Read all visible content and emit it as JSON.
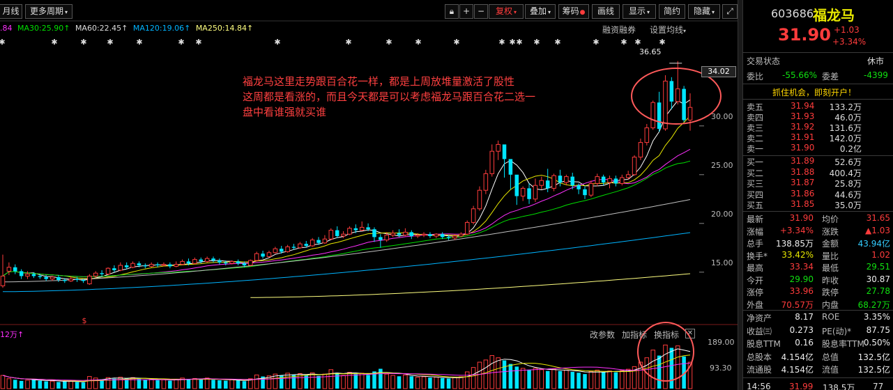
{
  "toolbar": {
    "left_tab_1": "月线",
    "left_tab_2": "更多周期",
    "fuquan": "复权",
    "diejia": "叠加",
    "chouma": "筹码",
    "huaxian": "画线",
    "xianshi": "显示",
    "jianyue": "简约",
    "yincang": "隐藏"
  },
  "ma_legend": {
    "ma_prev": ".84",
    "ma30": "MA30:25.90",
    "ma60": "MA60:22.45",
    "ma120": "MA120:19.06",
    "ma250": "MA250:14.84",
    "rongzi": "融资融券",
    "shezhi": "设置均线"
  },
  "colors": {
    "up": "#ff3c3c",
    "down": "#00e5ff",
    "ma5": "#ffffff",
    "ma10": "#e8e800",
    "ma20": "#ff30ff",
    "ma30": "#00e000",
    "ma60": "#c0c0c0",
    "ma120": "#00b4ff",
    "ma250": "#ffff80"
  },
  "annotation": {
    "line1": "福龙马这里走势跟百合花一样，都是上周放堆量激活了股性",
    "line2": "这周都是看涨的，而且今天都是可以考虑福龙马跟百合花二选一",
    "line3": "盘中看谁强就买谁"
  },
  "price_axis": {
    "current_tag": "34.02",
    "ticks": [
      "30.00",
      "25.00",
      "20.00",
      "15.00"
    ],
    "high_label": "36.65"
  },
  "volume_panel": {
    "legend": "12万",
    "gaicanshu": "改参数",
    "jiazhibiao": "加指标",
    "huanzhibiao": "换指标",
    "ticks": [
      "189.00",
      "93.30"
    ]
  },
  "chart_data": {
    "type": "candlestick",
    "title": "福龙马 603686",
    "y_ticks": [
      15.0,
      20.0,
      25.0,
      30.0,
      34.02
    ],
    "ylim": [
      12.2,
      37.2
    ],
    "high_marker": 36.65,
    "candles": [
      [
        13.6,
        14.6,
        16.8,
        13.4
      ],
      [
        15.1,
        15.5,
        16.0,
        14.7
      ],
      [
        15.5,
        15.1,
        15.8,
        14.8
      ],
      [
        15.1,
        14.6,
        15.3,
        14.3
      ],
      [
        14.6,
        14.8,
        15.1,
        14.3
      ],
      [
        14.8,
        14.6,
        15.0,
        14.4
      ],
      [
        14.6,
        14.5,
        14.8,
        14.3
      ],
      [
        14.5,
        14.3,
        14.7,
        14.1
      ],
      [
        14.3,
        14.5,
        14.6,
        14.1
      ],
      [
        14.5,
        14.2,
        14.7,
        14.0
      ],
      [
        14.2,
        14.1,
        14.4,
        13.9
      ],
      [
        14.1,
        14.3,
        14.6,
        14.0
      ],
      [
        14.3,
        14.2,
        14.5,
        14.0
      ],
      [
        14.2,
        14.1,
        14.3,
        13.9
      ],
      [
        13.8,
        14.6,
        14.8,
        13.7
      ],
      [
        14.6,
        14.9,
        15.1,
        14.4
      ],
      [
        14.9,
        14.8,
        15.2,
        14.6
      ],
      [
        14.8,
        15.4,
        15.5,
        14.7
      ],
      [
        15.4,
        15.2,
        15.7,
        15.0
      ],
      [
        15.2,
        15.7,
        16.0,
        15.1
      ],
      [
        15.7,
        15.5,
        16.0,
        15.3
      ],
      [
        15.5,
        15.9,
        16.1,
        15.4
      ],
      [
        15.9,
        15.7,
        16.1,
        15.5
      ],
      [
        15.7,
        15.6,
        15.9,
        15.4
      ],
      [
        15.6,
        15.8,
        16.0,
        15.5
      ],
      [
        15.8,
        15.7,
        16.0,
        15.5
      ],
      [
        15.7,
        15.8,
        16.0,
        15.6
      ],
      [
        15.8,
        15.6,
        16.0,
        15.4
      ],
      [
        15.6,
        15.8,
        16.1,
        15.5
      ],
      [
        15.8,
        16.1,
        16.3,
        15.7
      ],
      [
        16.1,
        15.9,
        16.4,
        15.7
      ],
      [
        15.9,
        16.3,
        16.5,
        15.8
      ],
      [
        16.3,
        16.1,
        16.5,
        15.9
      ],
      [
        16.1,
        16.4,
        16.6,
        16.0
      ],
      [
        16.4,
        16.2,
        16.6,
        16.0
      ],
      [
        16.2,
        16.0,
        16.4,
        15.8
      ],
      [
        16.0,
        15.9,
        16.2,
        15.7
      ],
      [
        15.9,
        16.1,
        16.2,
        15.8
      ],
      [
        16.1,
        15.9,
        16.3,
        15.7
      ],
      [
        15.9,
        15.7,
        16.1,
        15.5
      ],
      [
        15.7,
        16.2,
        16.3,
        15.6
      ],
      [
        16.2,
        16.9,
        17.1,
        16.1
      ],
      [
        16.9,
        16.6,
        17.2,
        16.4
      ],
      [
        16.6,
        17.0,
        17.2,
        16.5
      ],
      [
        17.0,
        17.4,
        17.6,
        16.9
      ],
      [
        17.4,
        17.1,
        17.7,
        16.9
      ],
      [
        17.1,
        17.6,
        17.8,
        17.0
      ],
      [
        17.6,
        17.5,
        17.9,
        17.3
      ],
      [
        17.5,
        17.9,
        18.1,
        17.4
      ],
      [
        17.9,
        17.7,
        18.2,
        17.5
      ],
      [
        17.7,
        18.3,
        18.5,
        17.6
      ],
      [
        18.3,
        18.0,
        18.6,
        17.8
      ],
      [
        18.0,
        18.4,
        18.8,
        17.9
      ],
      [
        18.4,
        19.3,
        19.5,
        18.3
      ],
      [
        19.3,
        18.7,
        19.7,
        18.5
      ],
      [
        18.7,
        18.9,
        19.2,
        18.5
      ],
      [
        18.9,
        19.5,
        19.7,
        18.8
      ],
      [
        19.5,
        19.3,
        19.9,
        19.0
      ],
      [
        19.3,
        19.6,
        20.2,
        19.2
      ],
      [
        19.6,
        19.4,
        20.0,
        19.2
      ],
      [
        19.4,
        18.6,
        19.6,
        18.1
      ],
      [
        18.6,
        18.3,
        18.9,
        17.5
      ],
      [
        18.3,
        18.8,
        19.1,
        18.1
      ],
      [
        18.8,
        19.0,
        19.3,
        18.6
      ],
      [
        19.0,
        18.8,
        19.4,
        18.6
      ],
      [
        18.8,
        19.1,
        19.5,
        18.7
      ],
      [
        19.1,
        18.7,
        19.3,
        18.4
      ],
      [
        18.7,
        18.8,
        19.0,
        18.5
      ],
      [
        18.8,
        18.9,
        19.1,
        18.6
      ],
      [
        18.9,
        18.7,
        19.1,
        18.5
      ],
      [
        18.7,
        18.9,
        19.0,
        18.5
      ],
      [
        18.9,
        18.6,
        19.1,
        18.4
      ],
      [
        18.6,
        18.5,
        18.8,
        18.3
      ],
      [
        18.5,
        18.7,
        18.9,
        18.3
      ],
      [
        18.7,
        18.9,
        19.1,
        18.6
      ],
      [
        18.9,
        20.1,
        20.3,
        18.8
      ],
      [
        20.1,
        21.5,
        21.8,
        19.9
      ],
      [
        21.5,
        23.4,
        23.8,
        21.3
      ],
      [
        23.4,
        25.1,
        25.5,
        23.0
      ],
      [
        25.1,
        27.4,
        28.1,
        24.8
      ],
      [
        27.4,
        28.1,
        28.5,
        26.5
      ],
      [
        28.1,
        26.6,
        27.9,
        24.7
      ],
      [
        26.6,
        25.0,
        26.4,
        23.5
      ],
      [
        25.0,
        22.8,
        24.6,
        21.9
      ],
      [
        22.8,
        23.6,
        23.8,
        22.3
      ],
      [
        23.6,
        22.5,
        24.1,
        22.0
      ],
      [
        22.5,
        23.9,
        24.6,
        22.2
      ],
      [
        23.9,
        24.4,
        24.8,
        23.5
      ],
      [
        24.4,
        23.6,
        25.6,
        23.2
      ],
      [
        23.6,
        24.9,
        25.1,
        23.3
      ],
      [
        24.9,
        24.2,
        25.5,
        23.8
      ],
      [
        24.2,
        24.8,
        25.0,
        23.9
      ],
      [
        24.8,
        23.9,
        25.2,
        23.5
      ],
      [
        23.9,
        23.5,
        24.1,
        23.0
      ],
      [
        23.5,
        22.9,
        23.8,
        22.5
      ],
      [
        22.9,
        24.1,
        24.4,
        22.7
      ],
      [
        24.1,
        24.8,
        25.1,
        23.8
      ],
      [
        24.8,
        24.2,
        25.0,
        23.9
      ],
      [
        24.2,
        24.6,
        24.9,
        23.6
      ],
      [
        24.6,
        24.1,
        24.9,
        23.8
      ],
      [
        24.1,
        24.7,
        25.0,
        23.9
      ],
      [
        24.7,
        25.0,
        25.4,
        24.5
      ],
      [
        25.0,
        26.8,
        27.0,
        24.9
      ],
      [
        26.8,
        28.3,
        28.7,
        26.5
      ],
      [
        28.3,
        29.8,
        30.2,
        28.0
      ],
      [
        29.8,
        32.4,
        32.6,
        29.6
      ],
      [
        32.4,
        29.7,
        33.5,
        29.4
      ],
      [
        29.7,
        34.6,
        35.2,
        29.5
      ],
      [
        34.6,
        32.5,
        35.0,
        31.7
      ],
      [
        32.5,
        33.8,
        36.65,
        32.2
      ],
      [
        33.8,
        30.6,
        34.1,
        30.4
      ],
      [
        30.6,
        31.9,
        33.34,
        29.51
      ]
    ],
    "ma_series": [
      {
        "name": "MA30",
        "last": 25.9
      },
      {
        "name": "MA60",
        "last": 22.45
      },
      {
        "name": "MA120",
        "last": 19.06
      },
      {
        "name": "MA250",
        "last": 14.84
      }
    ],
    "volume_ticks": [
      189.0,
      93.3
    ],
    "volume_max": 215,
    "volumes": [
      60,
      45,
      40,
      35,
      38,
      42,
      36,
      33,
      34,
      30,
      32,
      35,
      30,
      28,
      55,
      48,
      42,
      50,
      45,
      52,
      46,
      50,
      44,
      40,
      42,
      38,
      40,
      36,
      42,
      48,
      44,
      46,
      42,
      48,
      40,
      38,
      36,
      40,
      38,
      34,
      45,
      62,
      55,
      58,
      66,
      60,
      70,
      62,
      68,
      60,
      72,
      58,
      66,
      86,
      72,
      60,
      74,
      66,
      70,
      62,
      78,
      90,
      66,
      60,
      56,
      62,
      56,
      52,
      54,
      50,
      52,
      48,
      46,
      50,
      54,
      76,
      96,
      120,
      130,
      150,
      140,
      128,
      112,
      100,
      92,
      86,
      92,
      86,
      80,
      88,
      80,
      84,
      76,
      72,
      66,
      78,
      84,
      76,
      80,
      74,
      82,
      88,
      100,
      120,
      140,
      175,
      150,
      198,
      185,
      194,
      146,
      120
    ],
    "volume_colors_up": true
  },
  "sidebar": {
    "code": "603686",
    "name": "福龙马",
    "price": "31.90",
    "change": "+1.03",
    "change_pct": "+3.34%",
    "trade_state_label": "交易状态",
    "trade_state": "休市",
    "weibi_label": "委比",
    "weibi": "-55.66%",
    "weicha_label": "委差",
    "weicha": "-4399",
    "promo": "抓住机会，即刻开户！",
    "sells": [
      {
        "label": "卖五",
        "price": "31.94",
        "vol": "133.2万"
      },
      {
        "label": "卖四",
        "price": "31.93",
        "vol": "46.0万"
      },
      {
        "label": "卖三",
        "price": "31.92",
        "vol": "131.6万"
      },
      {
        "label": "卖二",
        "price": "31.91",
        "vol": "142.0万"
      },
      {
        "label": "卖一",
        "price": "31.90",
        "vol": "0.2亿"
      }
    ],
    "buys": [
      {
        "label": "买一",
        "price": "31.89",
        "vol": "52.6万"
      },
      {
        "label": "买二",
        "price": "31.88",
        "vol": "400.4万"
      },
      {
        "label": "买三",
        "price": "31.87",
        "vol": "25.8万"
      },
      {
        "label": "买四",
        "price": "31.86",
        "vol": "44.6万"
      },
      {
        "label": "买五",
        "price": "31.85",
        "vol": "35.0万"
      }
    ],
    "stats": [
      {
        "l1": "最新",
        "v1": "31.90",
        "c1": "red",
        "l2": "均价",
        "v2": "31.65",
        "c2": "red"
      },
      {
        "l1": "涨幅",
        "v1": "+3.34%",
        "c1": "red",
        "l2": "涨跌",
        "v2": "▲1.03",
        "c2": "red"
      },
      {
        "l1": "总手",
        "v1": "138.85万",
        "c1": "white",
        "l2": "金额",
        "v2": "43.94亿",
        "c2": "cyan"
      },
      {
        "l1": "换手*",
        "v1": "33.42%",
        "c1": "yellow",
        "l2": "量比",
        "v2": "1.02",
        "c2": "red"
      },
      {
        "l1": "最高",
        "v1": "33.34",
        "c1": "red",
        "l2": "最低",
        "v2": "29.51",
        "c2": "green"
      },
      {
        "l1": "今开",
        "v1": "29.90",
        "c1": "green",
        "l2": "昨收",
        "v2": "30.87",
        "c2": "white"
      },
      {
        "l1": "涨停",
        "v1": "33.96",
        "c1": "red",
        "l2": "跌停",
        "v2": "27.78",
        "c2": "green"
      },
      {
        "l1": "外盘",
        "v1": "70.57万",
        "c1": "red",
        "l2": "内盘",
        "v2": "68.27万",
        "c2": "green"
      }
    ],
    "fin": [
      {
        "l1": "净资产",
        "v1": "8.17",
        "l2": "ROE",
        "v2": "3.35%"
      },
      {
        "l1": "收益㈢",
        "v1": "0.273",
        "l2": "PE(动)*",
        "v2": "87.75"
      },
      {
        "l1": "股息TTM",
        "v1": "0.16",
        "l2": "股息率TTM",
        "v2": "0.50%"
      },
      {
        "l1": "总股本",
        "v1": "4.154亿",
        "l2": "总值",
        "v2": "132.5亿"
      },
      {
        "l1": "流通股",
        "v1": "4.154亿",
        "l2": "流值",
        "v2": "132.5亿"
      }
    ],
    "tick_time": "14:56",
    "tick_price": "31.99",
    "tick_vol": "138.5万",
    "tick_n": "77"
  }
}
